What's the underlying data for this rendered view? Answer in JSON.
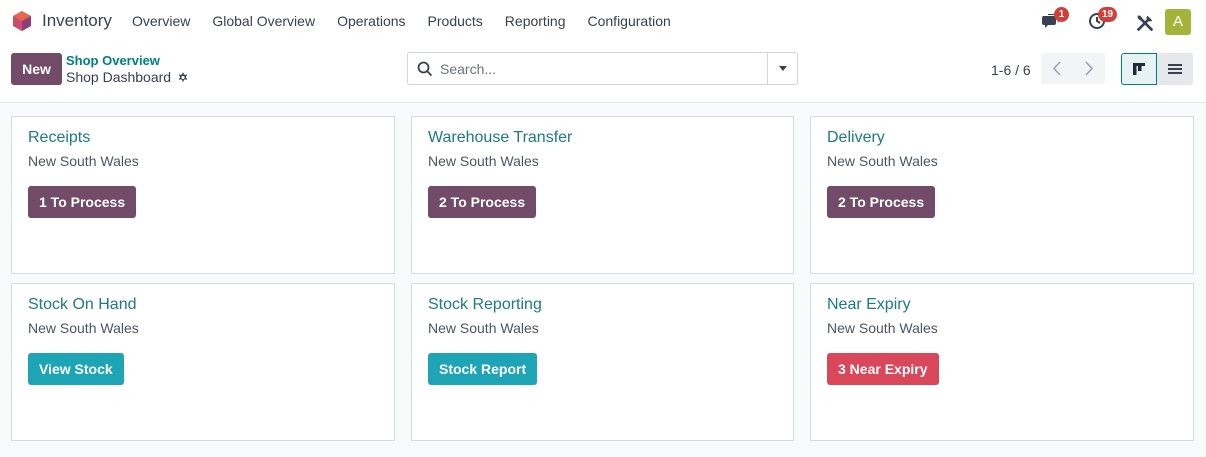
{
  "app": {
    "name": "Inventory"
  },
  "menu": [
    {
      "label": "Overview"
    },
    {
      "label": "Global Overview"
    },
    {
      "label": "Operations"
    },
    {
      "label": "Products"
    },
    {
      "label": "Reporting"
    },
    {
      "label": "Configuration"
    }
  ],
  "systray": {
    "messages_count": "1",
    "activities_count": "19",
    "avatar_letter": "A"
  },
  "control_panel": {
    "new_label": "New",
    "breadcrumb_parent": "Shop Overview",
    "breadcrumb_current": "Shop Dashboard",
    "search_placeholder": "Search...",
    "pager": "1-6 / 6"
  },
  "colors": {
    "primary": "#714b67",
    "info": "#17a2b8",
    "danger": "#dc4c64",
    "title": "#1d7a80"
  },
  "cards": [
    {
      "title": "Receipts",
      "subtitle": "New South Wales",
      "button": "1 To Process",
      "button_color": "#714b67"
    },
    {
      "title": "Warehouse Transfer",
      "subtitle": "New South Wales",
      "button": "2 To Process",
      "button_color": "#714b67"
    },
    {
      "title": "Delivery",
      "subtitle": "New South Wales",
      "button": "2 To Process",
      "button_color": "#714b67"
    },
    {
      "title": "Stock On Hand",
      "subtitle": "New South Wales",
      "button": "View Stock",
      "button_color": "#1ea5b5"
    },
    {
      "title": "Stock Reporting",
      "subtitle": "New South Wales",
      "button": "Stock Report",
      "button_color": "#1ea5b5"
    },
    {
      "title": "Near Expiry",
      "subtitle": "New South Wales",
      "button": "3 Near Expiry",
      "button_color": "#d9475b"
    }
  ]
}
